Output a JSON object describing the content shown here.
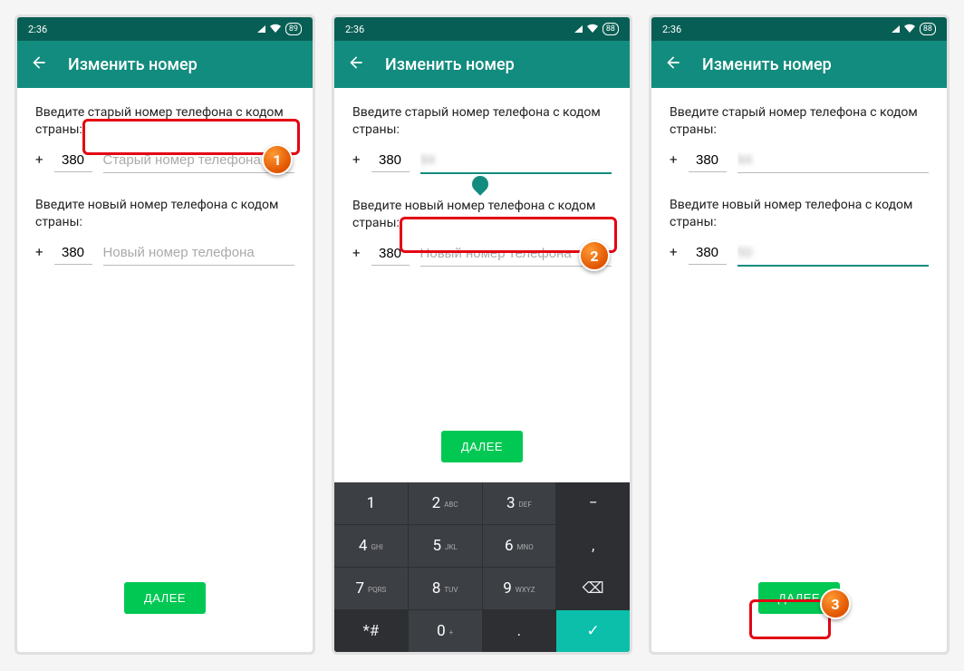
{
  "status": {
    "time": "2:36"
  },
  "appbar": {
    "title": "Изменить номер"
  },
  "labels": {
    "old": "Введите старый номер телефона с кодом страны:",
    "new": "Введите новый номер телефона с кодом страны:"
  },
  "placeholders": {
    "old": "Старый номер телефона",
    "new": "Новый номер телефона"
  },
  "prefix": "+",
  "screens": {
    "s1": {
      "battery": "89",
      "old_code": "380",
      "old_num": "",
      "new_code": "380",
      "new_num": ""
    },
    "s2": {
      "battery": "88",
      "old_code": "380",
      "old_num": "94",
      "new_code": "380",
      "new_num": ""
    },
    "s3": {
      "battery": "88",
      "old_code": "380",
      "old_num": "94",
      "new_code": "380",
      "new_num": "50"
    }
  },
  "button": {
    "next": "ДАЛЕЕ"
  },
  "keypad": [
    {
      "main": "1",
      "sub": ""
    },
    {
      "main": "2",
      "sub": "ABC"
    },
    {
      "main": "3",
      "sub": "DEF"
    },
    {
      "main": "−",
      "sub": "",
      "dark": true
    },
    {
      "main": "4",
      "sub": "GHI"
    },
    {
      "main": "5",
      "sub": "JKL"
    },
    {
      "main": "6",
      "sub": "MNO"
    },
    {
      "main": ",",
      "sub": "",
      "dark": true
    },
    {
      "main": "7",
      "sub": "PQRS"
    },
    {
      "main": "8",
      "sub": "TUV"
    },
    {
      "main": "9",
      "sub": "WXYZ"
    },
    {
      "main": "⌫",
      "sub": "",
      "dark": true
    },
    {
      "main": "*#",
      "sub": "",
      "dark": true
    },
    {
      "main": "0",
      "sub": "+"
    },
    {
      "main": ".",
      "sub": "",
      "dark": true
    },
    {
      "main": "✓",
      "sub": "",
      "accent": true
    }
  ],
  "badges": {
    "b1": "1",
    "b2": "2",
    "b3": "3"
  }
}
